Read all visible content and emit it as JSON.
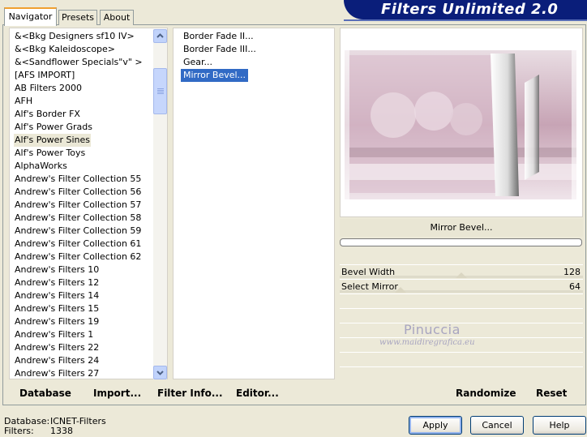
{
  "app": {
    "title": "Filters Unlimited 2.0"
  },
  "tabs": [
    {
      "label": "Navigator",
      "active": true
    },
    {
      "label": "Presets",
      "active": false
    },
    {
      "label": "About",
      "active": false
    }
  ],
  "filter_list": {
    "selected_index": 8,
    "items": [
      "&<Bkg Designers sf10 IV>",
      "&<Bkg Kaleidoscope>",
      "&<Sandflower Specials\"v\" >",
      "[AFS IMPORT]",
      "AB Filters 2000",
      "AFH",
      "Alf's Border FX",
      "Alf's Power Grads",
      "Alf's Power Sines",
      "Alf's Power Toys",
      "AlphaWorks",
      "Andrew's Filter Collection 55",
      "Andrew's Filter Collection 56",
      "Andrew's Filter Collection 57",
      "Andrew's Filter Collection 58",
      "Andrew's Filter Collection 59",
      "Andrew's Filter Collection 61",
      "Andrew's Filter Collection 62",
      "Andrew's Filters 10",
      "Andrew's Filters 12",
      "Andrew's Filters 14",
      "Andrew's Filters 15",
      "Andrew's Filters 19",
      "Andrew's Filters 1",
      "Andrew's Filters 22",
      "Andrew's Filters 24",
      "Andrew's Filters 27"
    ]
  },
  "effect_list": {
    "items": [
      "Border Fade II...",
      "Border Fade III...",
      "Gear...",
      "Mirror Bevel..."
    ],
    "selected": "Mirror Bevel..."
  },
  "preview": {
    "filter_name": "Mirror Bevel...",
    "progress": 0
  },
  "params": [
    {
      "label": "Bevel Width",
      "value": "128"
    },
    {
      "label": "Select Mirror",
      "value": "64"
    }
  ],
  "watermark": {
    "title": "Pinuccia",
    "url": "www.maidiregrafica.eu"
  },
  "bottom_buttons": {
    "database": "Database",
    "import": "Import...",
    "filter_info": "Filter Info...",
    "editor": "Editor...",
    "randomize": "Randomize",
    "reset": "Reset"
  },
  "status": {
    "database_label": "Database:",
    "database_value": "ICNET-Filters",
    "filters_label": "Filters:",
    "filters_value": "1338"
  },
  "dialog_buttons": {
    "apply": "Apply",
    "cancel": "Cancel",
    "help": "Help"
  },
  "colors": {
    "title_banner": "#0a1e7a",
    "selection": "#316ac5",
    "preview_tint": "#c9a9b8"
  }
}
